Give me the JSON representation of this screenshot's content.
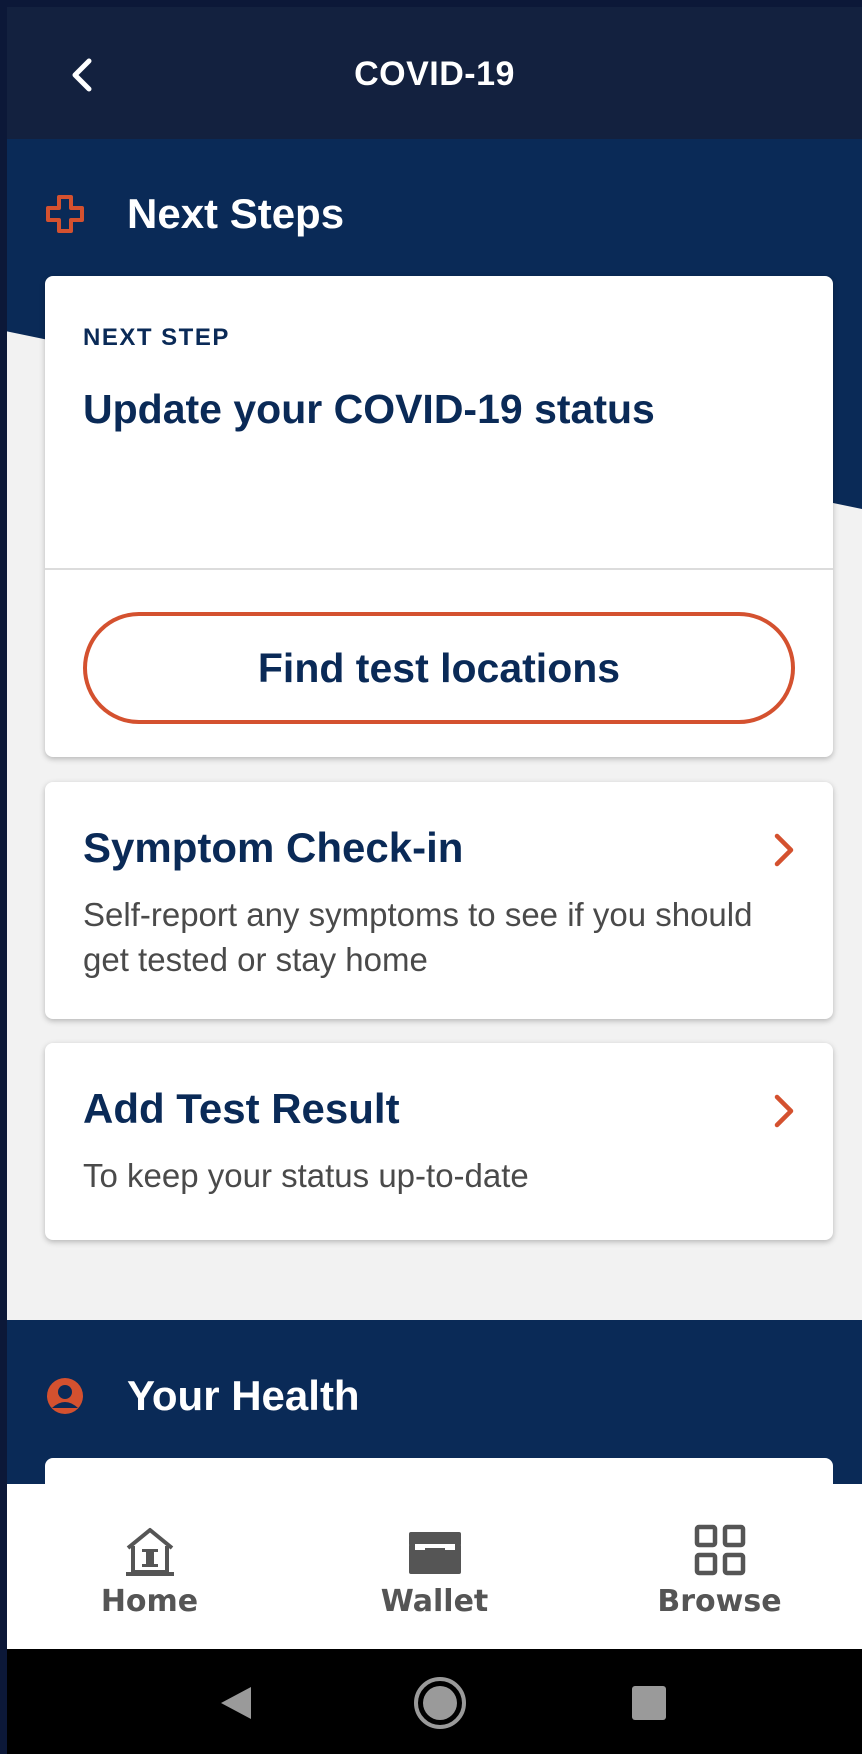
{
  "header": {
    "title": "COVID-19",
    "back_icon": "chevron-left-icon"
  },
  "next_steps": {
    "section_title": "Next Steps",
    "icon": "medical-cross-icon",
    "card": {
      "label": "NEXT STEP",
      "title": "Update your COVID-19 status",
      "button_label": "Find test locations"
    }
  },
  "links": [
    {
      "title": "Symptom Check-in",
      "description": "Self-report any symptoms to see if you should get tested or stay home",
      "icon": "chevron-right-icon"
    },
    {
      "title": "Add Test Result",
      "description": "To keep your status up-to-date",
      "icon": "chevron-right-icon"
    }
  ],
  "your_health": {
    "section_title": "Your Health",
    "icon": "person-circle-icon"
  },
  "bottom_nav": [
    {
      "label": "Home",
      "icon": "home-icon"
    },
    {
      "label": "Wallet",
      "icon": "wallet-icon"
    },
    {
      "label": "Browse",
      "icon": "grid-icon"
    }
  ],
  "system_nav": [
    "back-triangle-icon",
    "home-circle-icon",
    "recents-square-icon"
  ],
  "colors": {
    "navy": "#0a2a57",
    "header": "#13213f",
    "accent": "#d4512f"
  }
}
